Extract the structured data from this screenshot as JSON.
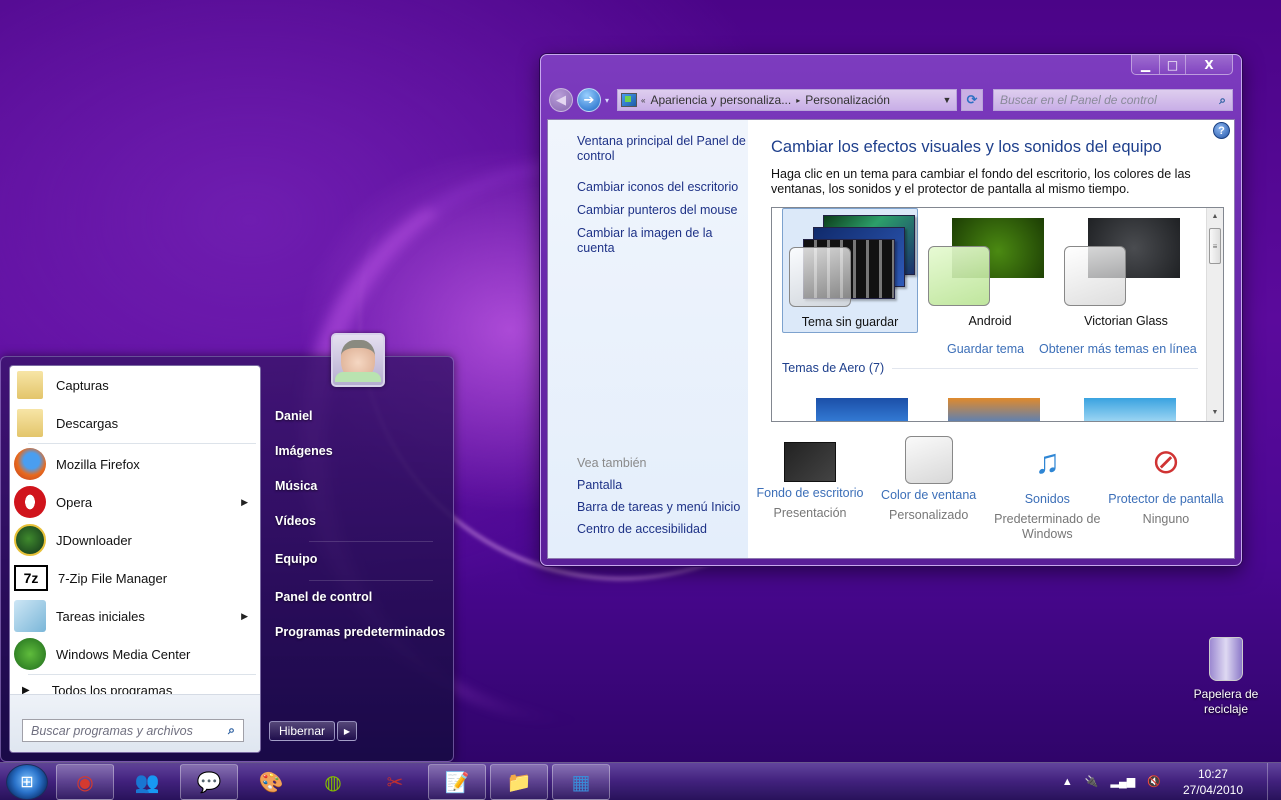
{
  "window": {
    "controls": {
      "minimize": "▁",
      "maximize": "□",
      "close": "X"
    },
    "nav": {
      "back_icon": "◀",
      "forward_icon": "➔",
      "history_icon": "▾"
    },
    "address": {
      "overflow": "«",
      "segments": [
        "Apariencia y personaliza...",
        "Personalización"
      ],
      "separator": "▸",
      "dropdown": "▼",
      "refresh_icon": "⟳"
    },
    "search": {
      "placeholder": "Buscar en el Panel de control",
      "icon": "⌕"
    },
    "left_pane": {
      "links": [
        "Ventana principal del Panel de control",
        "Cambiar iconos del escritorio",
        "Cambiar punteros del mouse",
        "Cambiar la imagen de la cuenta"
      ],
      "see_also": {
        "header": "Vea también",
        "links": [
          "Pantalla",
          "Barra de tareas y menú Inicio",
          "Centro de accesibilidad"
        ]
      }
    },
    "main": {
      "help_icon": "?",
      "title": "Cambiar los efectos visuales y los sonidos del equipo",
      "description": "Haga clic en un tema para cambiar el fondo del escritorio, los colores de las ventanas, los sonidos y el protector de pantalla al mismo tiempo.",
      "themes": [
        {
          "label": "Tema sin guardar",
          "selected": true
        },
        {
          "label": "Android",
          "selected": false
        },
        {
          "label": "Victorian Glass",
          "selected": false
        }
      ],
      "theme_links": {
        "save": "Guardar tema",
        "more_online": "Obtener más temas en línea"
      },
      "aero_header": "Temas de Aero (7)",
      "scrollbar": {
        "up": "▲",
        "down": "▼",
        "grip": "≡"
      },
      "settings": [
        {
          "name": "Fondo de escritorio",
          "value": "Presentación"
        },
        {
          "name": "Color de ventana",
          "value": "Personalizado"
        },
        {
          "name": "Sonidos",
          "value": "Predeterminado de Windows"
        },
        {
          "name": "Protector de pantalla",
          "value": "Ninguno"
        }
      ]
    }
  },
  "start_menu": {
    "pinned": [
      {
        "label": "Capturas",
        "icon": "folder-icon"
      },
      {
        "label": "Descargas",
        "icon": "folder-icon"
      }
    ],
    "recent": [
      {
        "label": "Mozilla Firefox",
        "icon": "firefox-icon",
        "submenu": false
      },
      {
        "label": "Opera",
        "icon": "opera-icon",
        "submenu": true
      },
      {
        "label": "JDownloader",
        "icon": "jdownloader-icon",
        "submenu": false
      },
      {
        "label": "7-Zip File Manager",
        "icon": "7zip-icon",
        "glyph": "7z",
        "submenu": false
      },
      {
        "label": "Tareas iniciales",
        "icon": "getting-started-icon",
        "submenu": true
      },
      {
        "label": "Windows Media Center",
        "icon": "media-center-icon",
        "submenu": false
      }
    ],
    "submenu_arrow": "▶",
    "all_programs": "Todos los programas",
    "all_programs_arrow": "▶",
    "search_placeholder": "Buscar programas y archivos",
    "search_icon": "⌕",
    "right_items": [
      "Daniel",
      "Imágenes",
      "Música",
      "Vídeos",
      "Equipo",
      "Panel de control",
      "Programas predeterminados"
    ],
    "power_button": "Hibernar",
    "power_arrow": "▶"
  },
  "desktop": {
    "recycle_bin": "Papelera de reciclaje"
  },
  "taskbar": {
    "start_icon": "⊞",
    "items": [
      {
        "name": "chrome",
        "glyph": "◉",
        "color": "#d43a2f",
        "running": true
      },
      {
        "name": "messenger",
        "glyph": "👥",
        "color": "#3fa34d",
        "running": false
      },
      {
        "name": "pidgin",
        "glyph": "💬",
        "color": "#8a6ab8",
        "running": true
      },
      {
        "name": "paint",
        "glyph": "🎨",
        "color": "#e0b040",
        "running": false
      },
      {
        "name": "spotify",
        "glyph": "◍",
        "color": "#84bd00",
        "running": false
      },
      {
        "name": "snipping-tool",
        "glyph": "✂",
        "color": "#c03030",
        "running": false
      },
      {
        "name": "notepad",
        "glyph": "📝",
        "color": "#9fd0f0",
        "running": true
      },
      {
        "name": "explorer",
        "glyph": "📁",
        "color": "#f0d070",
        "running": true
      },
      {
        "name": "control-panel",
        "glyph": "▦",
        "color": "#3a8ad6",
        "running": true
      }
    ],
    "tray": {
      "overflow": "▲",
      "power_icon": "🔌",
      "signal_icon": "▂▄▆",
      "volume_icon": "🔇",
      "time": "10:27",
      "date": "27/04/2010"
    }
  }
}
